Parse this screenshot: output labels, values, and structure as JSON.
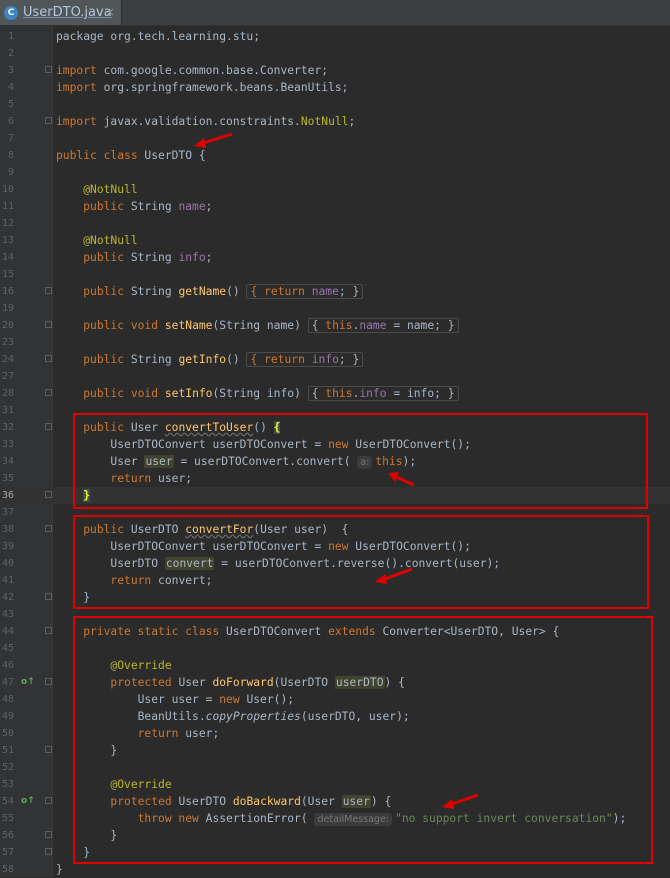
{
  "tab": {
    "icon_letter": "C",
    "file_name": "UserDTO.java",
    "close_glyph": "×"
  },
  "lines": {
    "1": "package org.tech.learning.stu;",
    "3a": "import",
    "3b": " com.google.common.base.Converter;",
    "4a": "import",
    "4b": " org.springframework.beans.BeanUtils;",
    "6a": "import",
    "6b": " javax.validation.constraints.",
    "6c": "NotNull",
    "6d": ";",
    "8a": "public class",
    "8b": " UserDTO {",
    "10": "@NotNull",
    "11a": "public",
    "11b": " String ",
    "11c": "name",
    "11d": ";",
    "13": "@NotNull",
    "14a": "public",
    "14b": " String ",
    "14c": "info",
    "14d": ";",
    "16a": "public",
    "16b": " String ",
    "16c": "getName",
    "16d": "() ",
    "16e": "{ return ",
    "16f": "name",
    "16g": "; }",
    "20a": "public void",
    "20b": "setName",
    "20c": "(String name) ",
    "20d": "{ ",
    "20e": "this",
    "20f": ".",
    "20g": "name",
    "20h": " = name; }",
    "24a": "public",
    "24b": " String ",
    "24c": "getInfo",
    "24d": "() ",
    "24e": "{ return ",
    "24f": "info",
    "24g": "; }",
    "28a": "public void",
    "28b": "setInfo",
    "28c": "(String info) ",
    "28d": "{ ",
    "28e": "this",
    "28f": ".",
    "28g": "info",
    "28h": " = info; }",
    "32a": "public",
    "32b": " User ",
    "32c": "convertToUser",
    "32d": "() ",
    "32e": "{",
    "33a": "UserDTOConvert userDTOConvert = ",
    "33b": "new",
    "33c": " UserDTOConvert();",
    "34a": "User ",
    "34b": "user",
    "34c": " = userDTOConvert.convert( ",
    "34d": "a:",
    "34e": "this",
    "34f": ");",
    "35a": "return",
    "35b": " user;",
    "36": "}",
    "38a": "public",
    "38b": " UserDTO ",
    "38c": "convertFor",
    "38d": "(User user)  {",
    "39a": "UserDTOConvert userDTOConvert = ",
    "39b": "new",
    "39c": " UserDTOConvert();",
    "40a": "UserDTO ",
    "40b": "convert",
    "40c": " = userDTOConvert.reverse().convert(user);",
    "41a": "return",
    "41b": " convert;",
    "42": "}",
    "44a": "private static class",
    "44b": " UserDTOConvert ",
    "44c": "extends",
    "44d": " Converter<UserDTO, User> {",
    "46": "@Override",
    "47a": "protected",
    "47b": " User ",
    "47c": "doForward",
    "47d": "(UserDTO ",
    "47e": "userDTO",
    "47f": ") {",
    "48a": "User user = ",
    "48b": "new",
    "48c": " User();",
    "49a": "BeanUtils.",
    "49b": "copyProperties",
    "49c": "(userDTO, user);",
    "50a": "return",
    "50b": " user;",
    "51": "}",
    "53": "@Override",
    "54a": "protected",
    "54b": " UserDTO ",
    "54c": "doBackward",
    "54d": "(User ",
    "54e": "user",
    "54f": ") {",
    "55a": "throw new",
    "55b": " AssertionError( ",
    "55c": "detailMessage:",
    "55d": "\"no support invert conversation\"",
    "55e": ");",
    "56": "}",
    "57": "}",
    "58": "}"
  },
  "line_numbers": [
    "1",
    "2",
    "3",
    "4",
    "5",
    "6",
    "7",
    "8",
    "9",
    "10",
    "11",
    "12",
    "13",
    "14",
    "15",
    "16",
    "19",
    "20",
    "23",
    "24",
    "27",
    "28",
    "31",
    "32",
    "33",
    "34",
    "35",
    "36",
    "37",
    "38",
    "39",
    "40",
    "41",
    "42",
    "43",
    "44",
    "45",
    "46",
    "47",
    "48",
    "49",
    "50",
    "51",
    "52",
    "53",
    "54",
    "55",
    "56",
    "57",
    "58"
  ],
  "override_marker": "o↑",
  "colors": {
    "background": "#2b2b2b",
    "keyword": "#cc7832",
    "annotation": "#bbb529",
    "field": "#9876aa",
    "method": "#ffc66d",
    "string": "#6a8759",
    "annotation_box": "#e00000"
  }
}
